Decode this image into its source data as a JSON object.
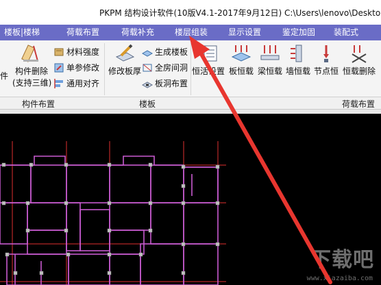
{
  "window": {
    "title": "PKPM 结构设计软件(10版V4.1-2017年9月12日) C:\\Users\\lenovo\\Desktop"
  },
  "menu": {
    "tabs": [
      "楼板|楼梯",
      "荷载布置",
      "荷载补充",
      "楼层组装",
      "显示设置",
      "鉴定加固",
      "装配式"
    ],
    "active": "楼层组装"
  },
  "ribbon": {
    "component_group": {
      "label": "构件布置",
      "partial_item": "件",
      "delete_label_line1": "构件删除",
      "delete_label_line2": "(支持三维)",
      "material_strength": "材料强度",
      "single_param": "单参修改",
      "align": "通用对齐"
    },
    "slab_group": {
      "label": "楼板",
      "modify_thickness": "修改板厚",
      "generate_slab": "生成楼板",
      "whole_room_hole": "全房间洞",
      "slab_hole": "板洞布置"
    },
    "load_group": {
      "label": "荷载布置",
      "dead_live_setting": "恒活设置",
      "slab_dead_load": "板恒载",
      "beam_dead_load": "梁恒载",
      "wall_dead_load": "墙恒载",
      "node_dead_load": "节点恒",
      "delete_dead_load": "恒载删除"
    }
  },
  "watermark": {
    "text": "下载吧",
    "url": "www.xiazaiba.com"
  },
  "colors": {
    "menu_bar": "#6a6cc6",
    "canvas_bg": "#000000",
    "plan_lines": "#c95bd0",
    "axis_lines": "#e03030",
    "arrow": "#e8362f"
  }
}
